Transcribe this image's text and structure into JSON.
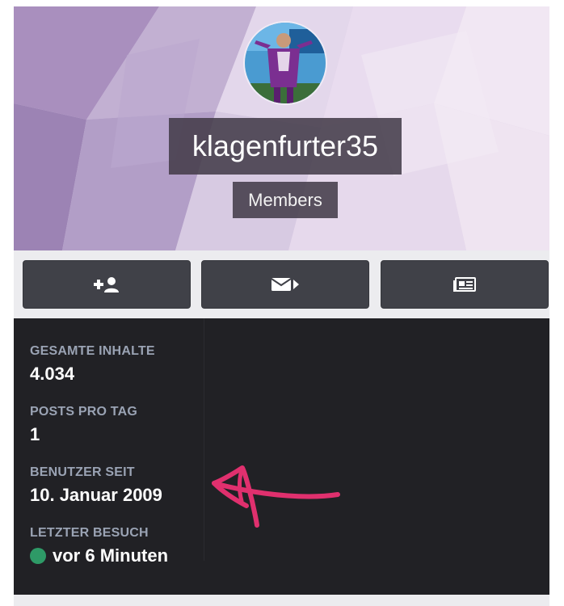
{
  "profile": {
    "username": "klagenfurter35",
    "group": "Members",
    "avatar_icon": "user-avatar-photo"
  },
  "actions": [
    {
      "icon": "add-friend-icon",
      "label": "Follow"
    },
    {
      "icon": "message-icon",
      "label": "Message"
    },
    {
      "icon": "activity-icon",
      "label": "Activity"
    }
  ],
  "stats": {
    "total_content_label": "GESAMTE INHALTE",
    "total_content_value": "4.034",
    "posts_per_day_label": "POSTS PRO TAG",
    "posts_per_day_value": "1",
    "member_since_label": "BENUTZER SEIT",
    "member_since_value": "10. Januar 2009",
    "last_visit_label": "LETZTER BESUCH",
    "last_visit_value": "vor 6 Minuten"
  },
  "colors": {
    "online": "#2e9a67",
    "annotation": "#e0306e",
    "button": "#404148",
    "stats_bg": "#212125"
  }
}
